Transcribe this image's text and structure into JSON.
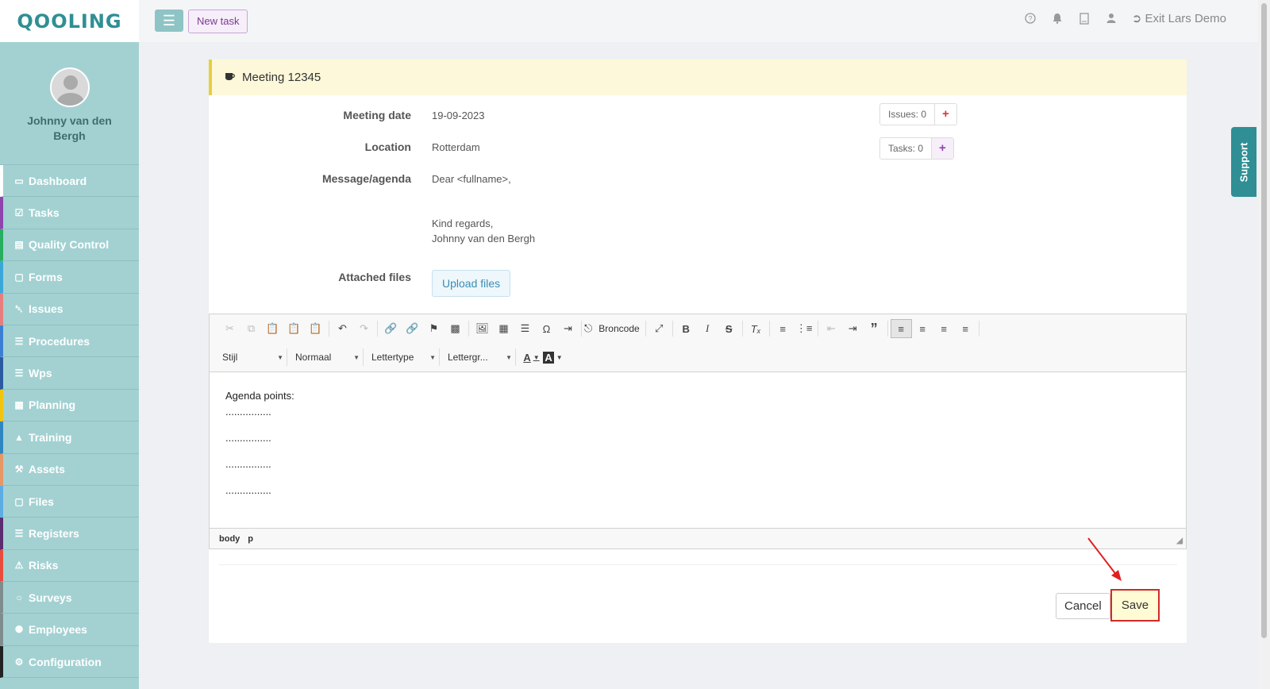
{
  "logo": "Qooling",
  "topbar": {
    "new_task": "New task",
    "exit_label": "Exit Lars Demo"
  },
  "profile": {
    "name": "Johnny van den Bergh"
  },
  "nav": [
    {
      "label": "Dashboard",
      "icon": "monitor-icon",
      "color": "#ffffff"
    },
    {
      "label": "Tasks",
      "icon": "checkbox-icon",
      "color": "#8e44ad"
    },
    {
      "label": "Quality Control",
      "icon": "book-icon",
      "color": "#27ae60"
    },
    {
      "label": "Forms",
      "icon": "document-icon",
      "color": "#3ba7d8"
    },
    {
      "label": "Issues",
      "icon": "bell-icon",
      "color": "#e67e7e"
    },
    {
      "label": "Procedures",
      "icon": "list-icon",
      "color": "#3b7fd4"
    },
    {
      "label": "Wps",
      "icon": "list-icon",
      "color": "#2c5aa0"
    },
    {
      "label": "Planning",
      "icon": "calendar-icon",
      "color": "#f1c40f"
    },
    {
      "label": "Training",
      "icon": "graduation-icon",
      "color": "#2e86c1"
    },
    {
      "label": "Assets",
      "icon": "wrench-icon",
      "color": "#e59866"
    },
    {
      "label": "Files",
      "icon": "file-icon",
      "color": "#5dade2"
    },
    {
      "label": "Registers",
      "icon": "list-icon",
      "color": "#5b2c6f"
    },
    {
      "label": "Risks",
      "icon": "warning-icon",
      "color": "#e74c3c"
    },
    {
      "label": "Surveys",
      "icon": "comment-icon",
      "color": "#7f8c8d"
    },
    {
      "label": "Employees",
      "icon": "users-icon",
      "color": "#7f8c8d"
    },
    {
      "label": "Configuration",
      "icon": "gear-icon",
      "color": "#222222"
    }
  ],
  "card": {
    "title": "Meeting 12345",
    "meeting_date_label": "Meeting date",
    "meeting_date": "19-09-2023",
    "location_label": "Location",
    "location": "Rotterdam",
    "message_label": "Message/agenda",
    "message_greeting": "Dear <fullname>,",
    "message_closing": "Kind regards,",
    "message_signature": "Johnny van den Bergh",
    "attached_label": "Attached files",
    "upload_label": "Upload files",
    "issues_label": "Issues: 0",
    "tasks_label": "Tasks: 0"
  },
  "editor": {
    "style_combo": "Stijl",
    "format_combo": "Normaal",
    "font_combo": "Lettertype",
    "size_combo": "Lettergr...",
    "source_label": "Broncode",
    "content": [
      "Agenda points:",
      "................",
      "................",
      "................",
      "................"
    ],
    "path": [
      "body",
      "p"
    ]
  },
  "actions": {
    "cancel": "Cancel",
    "save": "Save"
  },
  "support": "Support"
}
